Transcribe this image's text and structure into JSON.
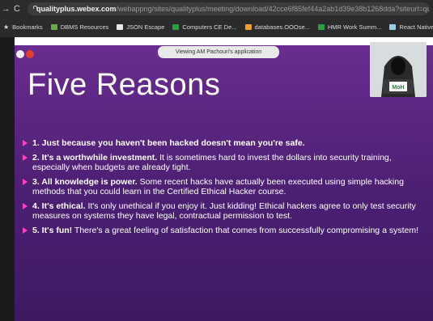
{
  "browser": {
    "nav": {
      "back": "→",
      "reload": "C"
    },
    "url": {
      "domain": "qualityplus.webex.com",
      "path": "/webappng/sites/qualityplus/meeting/download/42cce6f85fef44a2ab1d39e38b1268dda?siteurl=qualityplusAM"
    },
    "bookmarks": [
      {
        "label": "Bookmarks",
        "icon": "star-icon"
      },
      {
        "label": "DBMS Resources",
        "icon": "bookmark-icon"
      },
      {
        "label": "JSON Escape",
        "icon": "bookmark-icon"
      },
      {
        "label": "Computers CE De...",
        "icon": "bookmark-icon"
      },
      {
        "label": "databases.OOOse...",
        "icon": "bookmark-icon"
      },
      {
        "label": "HMR Work Summ...",
        "icon": "bookmark-icon"
      },
      {
        "label": "React Native",
        "icon": "bookmark-icon"
      }
    ]
  },
  "viewer": {
    "banner": "Viewing AM Pachouri's application"
  },
  "slide": {
    "title": "Five Reasons",
    "presenter_badge": "MoH",
    "reasons": [
      {
        "bold": "1. Just because you haven't been hacked doesn't mean you're safe.",
        "text": ""
      },
      {
        "bold": "2. It's a worthwhile investment.",
        "text": " It is sometimes hard to invest the dollars into security training, especially when budgets are already tight."
      },
      {
        "bold": "3. All knowledge is power.",
        "text": " Some recent hacks have actually been executed using simple hacking methods that you could learn in the Certified Ethical Hacker course."
      },
      {
        "bold": "4. It's ethical.",
        "text": " It's only unethical if you enjoy it. Just kidding! Ethical hackers agree to only test security measures on systems they have legal, contractual permission to test."
      },
      {
        "bold": "5. It's fun!",
        "text": " There's a great feeling of satisfaction that comes from successfully compromising a system!"
      }
    ]
  },
  "colors": {
    "slide_top": "#6a2c90",
    "slide_bottom": "#3e1a62",
    "bullet": "#ff3ec1",
    "chrome": "#2b2b2e"
  }
}
